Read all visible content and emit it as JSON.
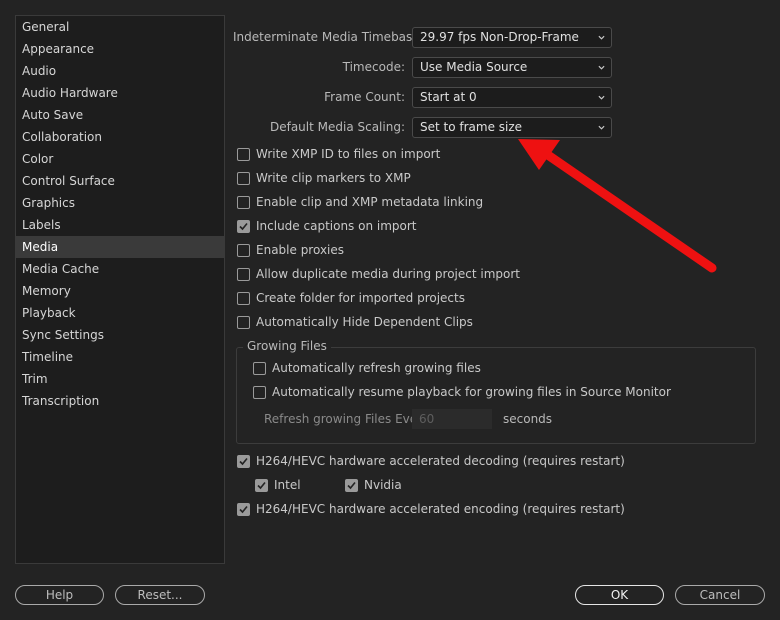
{
  "sidebar": {
    "items": [
      {
        "label": "General"
      },
      {
        "label": "Appearance"
      },
      {
        "label": "Audio"
      },
      {
        "label": "Audio Hardware"
      },
      {
        "label": "Auto Save"
      },
      {
        "label": "Collaboration"
      },
      {
        "label": "Color"
      },
      {
        "label": "Control Surface"
      },
      {
        "label": "Graphics"
      },
      {
        "label": "Labels"
      },
      {
        "label": "Media"
      },
      {
        "label": "Media Cache"
      },
      {
        "label": "Memory"
      },
      {
        "label": "Playback"
      },
      {
        "label": "Sync Settings"
      },
      {
        "label": "Timeline"
      },
      {
        "label": "Trim"
      },
      {
        "label": "Transcription"
      }
    ],
    "selected": "Media"
  },
  "fields": {
    "timebase": {
      "label": "Indeterminate Media Timebase:",
      "value": "29.97 fps Non-Drop-Frame"
    },
    "timecode": {
      "label": "Timecode:",
      "value": "Use Media Source"
    },
    "frame_count": {
      "label": "Frame Count:",
      "value": "Start at 0"
    },
    "scaling": {
      "label": "Default Media Scaling:",
      "value": "Set to frame size"
    }
  },
  "checkboxes": [
    {
      "label": "Write XMP ID to files on import",
      "checked": false
    },
    {
      "label": "Write clip markers to XMP",
      "checked": false
    },
    {
      "label": "Enable clip and XMP metadata linking",
      "checked": false
    },
    {
      "label": "Include captions on import",
      "checked": true
    },
    {
      "label": "Enable proxies",
      "checked": false
    },
    {
      "label": "Allow duplicate media during project import",
      "checked": false
    },
    {
      "label": "Create folder for imported projects",
      "checked": false
    },
    {
      "label": "Automatically Hide Dependent Clips",
      "checked": false
    }
  ],
  "growing_files": {
    "title": "Growing Files",
    "auto_refresh": {
      "label": "Automatically refresh growing files",
      "checked": false
    },
    "auto_resume": {
      "label": "Automatically resume playback for growing files in Source Monitor",
      "checked": false
    },
    "refresh_label": "Refresh growing Files Every",
    "refresh_value": "60",
    "refresh_unit": "seconds"
  },
  "hardware": {
    "decoding": {
      "label": "H264/HEVC hardware accelerated decoding (requires restart)",
      "checked": true
    },
    "intel": {
      "label": "Intel",
      "checked": true
    },
    "nvidia": {
      "label": "Nvidia",
      "checked": true
    },
    "encoding": {
      "label": "H264/HEVC hardware accelerated encoding (requires restart)",
      "checked": true
    }
  },
  "buttons": {
    "help": "Help",
    "reset": "Reset...",
    "ok": "OK",
    "cancel": "Cancel"
  },
  "colors": {
    "background": "#232323",
    "annotation_arrow": "#ee1111"
  }
}
